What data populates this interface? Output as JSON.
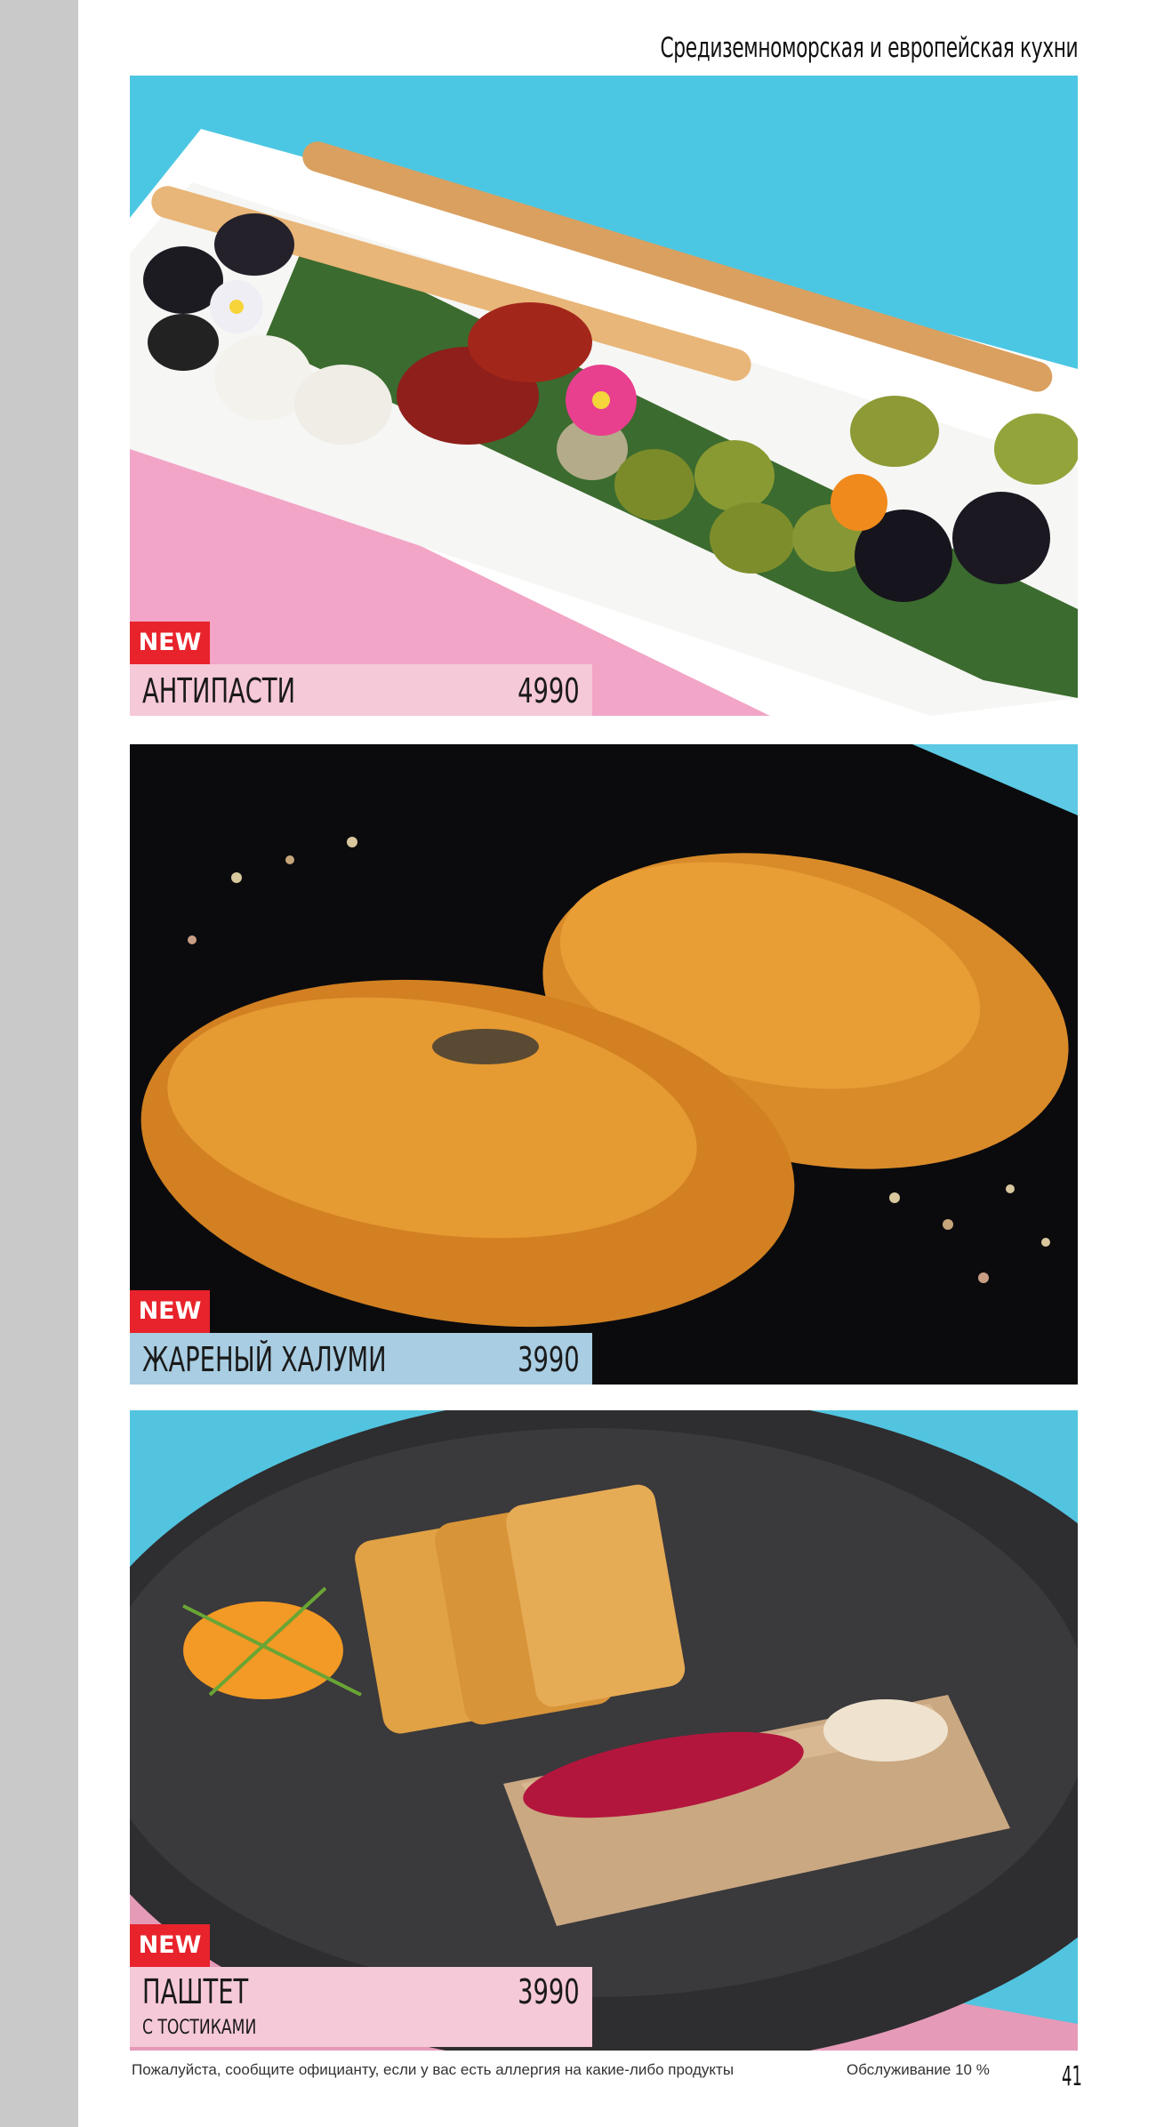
{
  "header": {
    "title": "Средиземноморская и европейская кухни"
  },
  "items": [
    {
      "badge": "NEW",
      "name": "АНТИПАСТИ",
      "price": "4990",
      "subtitle": "",
      "label_color": "#f6c9d8"
    },
    {
      "badge": "NEW",
      "name": "ЖАРЕНЫЙ ХАЛУМИ",
      "price": "3990",
      "subtitle": "",
      "label_color": "#a9cde2"
    },
    {
      "badge": "NEW",
      "name": "ПАШТЕТ",
      "price": "3990",
      "subtitle": "С ТОСТИКАМИ",
      "label_color": "#f6c9d8"
    }
  ],
  "footer": {
    "allergy_note": "Пожалуйста, сообщите официанту, если у вас есть аллергия на какие-либо продукты",
    "service": "Обслуживание 10 %",
    "page_number": "41"
  },
  "colors": {
    "badge": "#e8232b",
    "background_blue": "#4cc7e3",
    "background_pink": "#f2a5c6",
    "sidebar_gray": "#c9c9c9"
  }
}
